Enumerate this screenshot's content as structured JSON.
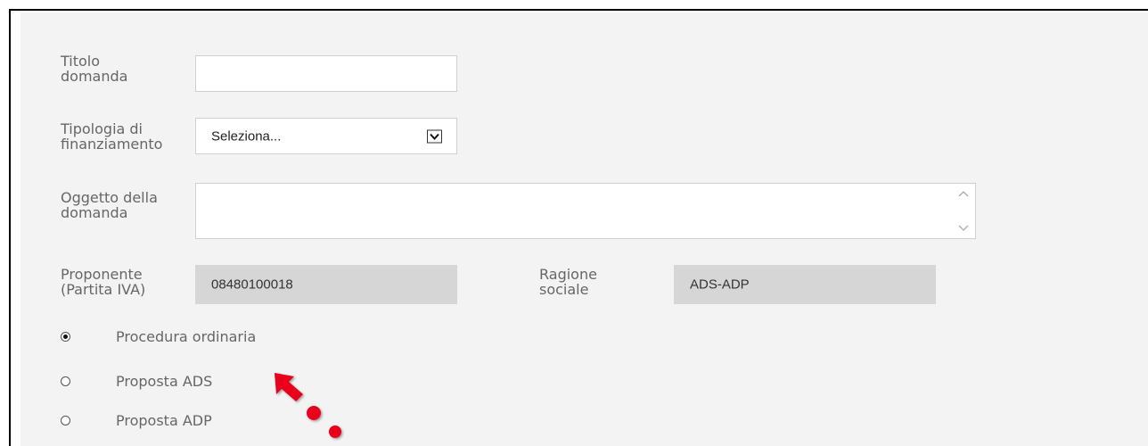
{
  "form": {
    "titolo": {
      "label": "Titolo\ndomanda",
      "value": ""
    },
    "tipologia": {
      "label": "Tipologia di\nfinanziamento",
      "selected": "Seleziona..."
    },
    "oggetto": {
      "label": "Oggetto della\ndomanda",
      "value": ""
    },
    "proponente": {
      "label": "Proponente\n(Partita IVA)",
      "value": "08480100018"
    },
    "ragione": {
      "label": "Ragione\nsociale",
      "value": "ADS-ADP"
    },
    "procedure": {
      "options": [
        {
          "label": "Procedura ordinaria",
          "checked": true
        },
        {
          "label": "Proposta ADS",
          "checked": false
        },
        {
          "label": "Proposta ADP",
          "checked": false
        }
      ]
    }
  },
  "colors": {
    "panel_bg": "#f3f3f3",
    "label_text": "#666666",
    "readonly_bg": "#d6d6d6",
    "annotation_red": "#e8001c"
  },
  "icons": {
    "select_arrow": "chevron-down-icon",
    "textarea_scroll_up": "chevron-up-icon",
    "textarea_scroll_down": "chevron-down-icon",
    "annotation": "red-arrow-icon"
  }
}
